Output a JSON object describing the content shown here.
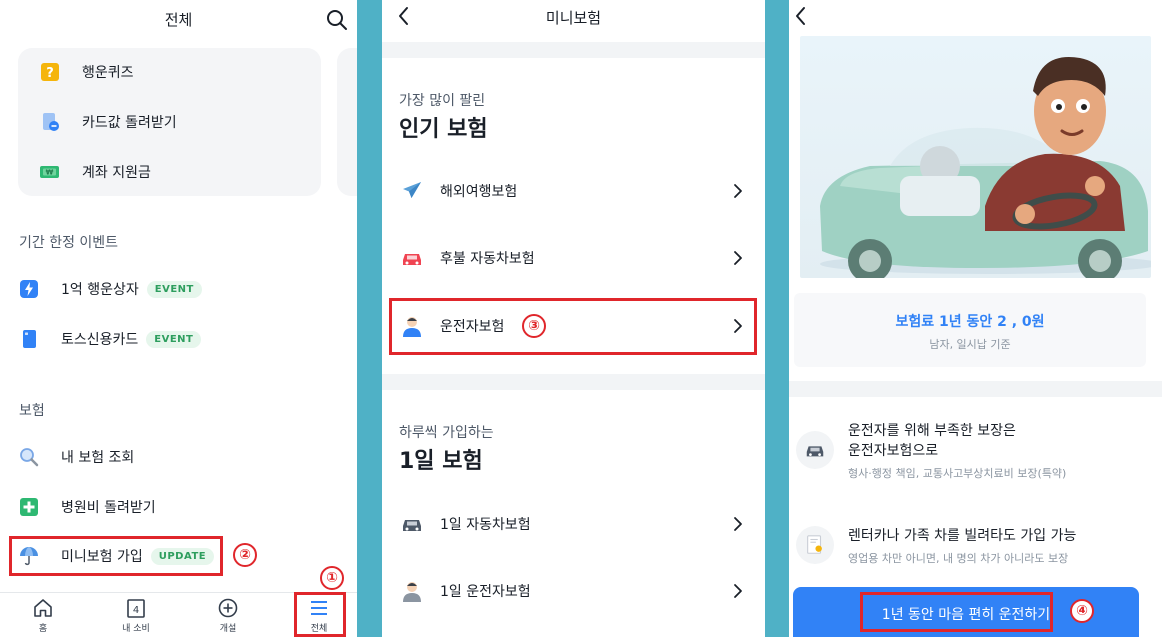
{
  "panel1": {
    "header_title": "전체",
    "top_card": {
      "items": [
        {
          "label": "행운퀴즈",
          "icon": "question-icon"
        },
        {
          "label": "카드값 돌려받기",
          "icon": "card-refund-icon"
        },
        {
          "label": "계좌 지원금",
          "icon": "won-bill-icon"
        }
      ]
    },
    "section_events": {
      "title": "기간 한정 이벤트",
      "items": [
        {
          "label": "1억 행운상자",
          "badge": "EVENT",
          "icon": "lightning-icon"
        },
        {
          "label": "토스신용카드",
          "badge": "EVENT",
          "icon": "credit-card-icon"
        }
      ]
    },
    "section_insurance": {
      "title": "보험",
      "items": [
        {
          "label": "내 보험 조회",
          "icon": "magnifier-icon"
        },
        {
          "label": "병원비 돌려받기",
          "icon": "plus-icon"
        },
        {
          "label": "미니보험 가입",
          "badge": "UPDATE",
          "icon": "umbrella-icon"
        }
      ]
    },
    "tabs": [
      {
        "label": "홈",
        "icon": "home-icon"
      },
      {
        "label": "내 소비",
        "icon": "calendar-icon",
        "icon_text": "4"
      },
      {
        "label": "개설",
        "icon": "plus-circle-icon"
      },
      {
        "label": "전체",
        "icon": "menu-icon"
      }
    ],
    "annotations": {
      "step1": "①",
      "step2": "②"
    }
  },
  "panel2": {
    "header_title": "미니보험",
    "popular": {
      "subtitle": "가장 많이 팔린",
      "title": "인기 보험",
      "items": [
        {
          "label": "해외여행보험",
          "icon": "airplane-icon"
        },
        {
          "label": "후불 자동차보험",
          "icon": "car-icon"
        },
        {
          "label": "운전자보험",
          "icon": "driver-icon"
        }
      ]
    },
    "daily": {
      "subtitle": "하루씩 가입하는",
      "title": "1일 보험",
      "items": [
        {
          "label": "1일 자동차보험",
          "icon": "car-dark-icon"
        },
        {
          "label": "1일 운전자보험",
          "icon": "driver-icon"
        }
      ]
    },
    "annotations": {
      "step3": "③"
    }
  },
  "panel3": {
    "price": {
      "main": "보험료 1년 동안 2  ,    0원",
      "sub": "남자, 일시납 기준"
    },
    "features": [
      {
        "title_line1": "운전자를 위해 부족한 보장은",
        "title_line2": "운전자보험으로",
        "desc": "형사·행정 책임, 교통사고부상치료비 보장(특약)",
        "icon": "car-icon"
      },
      {
        "title_line1": "렌터카나 가족 차를 빌려타도 가입 가능",
        "desc": "영업용 차만 아니면, 내 명의 차가 아니라도 보장",
        "icon": "certificate-icon"
      }
    ],
    "cta_label": "1년 동안 마음 편히 운전하기",
    "annotations": {
      "step4": "④"
    }
  },
  "colors": {
    "accent": "#3182f6",
    "annotation": "#e0262b",
    "background": "#4fb1c6"
  }
}
